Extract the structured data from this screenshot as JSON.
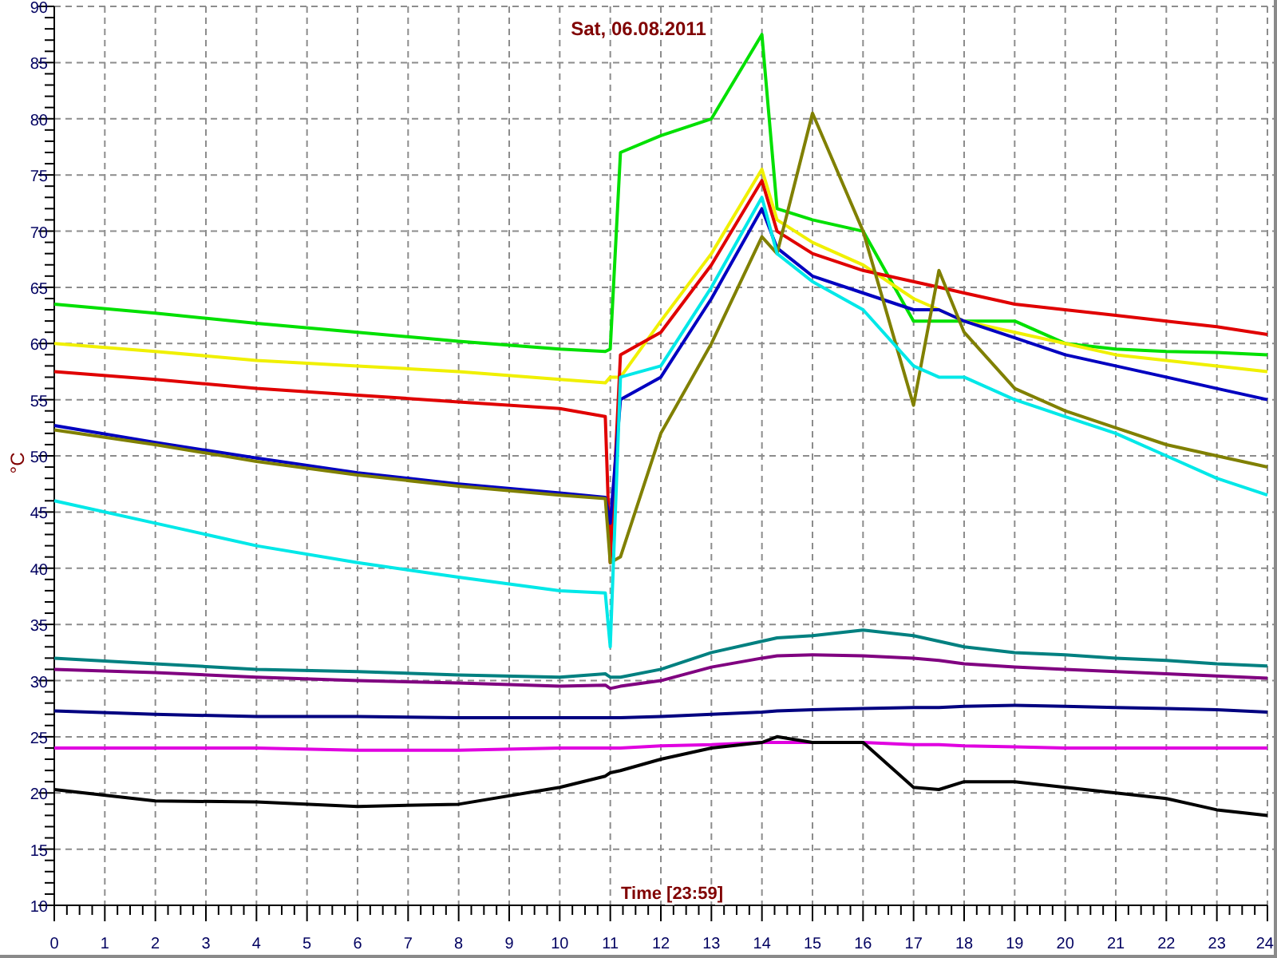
{
  "chart": {
    "chart_data": {
      "type": "line",
      "title": "Sat, 06.08.2011",
      "xlabel": "Time [23:59]",
      "ylabel": "°C",
      "x": [
        0,
        2,
        4,
        6,
        8,
        10,
        10.9,
        11,
        11.2,
        12,
        13,
        14,
        14.3,
        15,
        16,
        17,
        17.5,
        18,
        19,
        20,
        21,
        22,
        23,
        24
      ],
      "xlim": [
        0,
        24
      ],
      "ylim": [
        10,
        90
      ],
      "grid": true,
      "xticks": [
        0,
        1,
        2,
        3,
        4,
        5,
        6,
        7,
        8,
        9,
        10,
        11,
        12,
        13,
        14,
        15,
        16,
        17,
        18,
        19,
        20,
        21,
        22,
        23,
        24
      ],
      "yticks": [
        10,
        15,
        20,
        25,
        30,
        35,
        40,
        45,
        50,
        55,
        60,
        65,
        70,
        75,
        80,
        85,
        90
      ],
      "series": [
        {
          "color": "#00e000",
          "values": [
            63.5,
            62.7,
            61.8,
            61,
            60.2,
            59.5,
            59.3,
            59.5,
            77,
            78.5,
            80,
            87.5,
            72,
            71,
            70,
            62,
            62,
            62,
            62,
            60,
            59.5,
            59.3,
            59.2,
            59
          ]
        },
        {
          "color": "#f0f000",
          "values": [
            60,
            59.3,
            58.5,
            58,
            57.5,
            56.8,
            56.5,
            57,
            57,
            62,
            68,
            75.5,
            71,
            69,
            67,
            64,
            63,
            62,
            61,
            60,
            59,
            58.5,
            58,
            57.5
          ]
        },
        {
          "color": "#e00000",
          "values": [
            57.5,
            56.8,
            56,
            55.4,
            54.8,
            54.2,
            53.5,
            40.5,
            59,
            61,
            67,
            74.5,
            70,
            68,
            66.5,
            65.5,
            65,
            64.5,
            63.5,
            63,
            62.5,
            62,
            61.5,
            60.8
          ]
        },
        {
          "color": "#0000c0",
          "values": [
            52.7,
            51.2,
            49.8,
            48.5,
            47.5,
            46.7,
            46.3,
            44,
            55,
            57,
            64,
            72,
            68.5,
            66,
            64.5,
            63,
            63,
            62,
            60.5,
            59,
            58,
            57,
            56,
            55
          ]
        },
        {
          "color": "#808000",
          "values": [
            52.3,
            51,
            49.5,
            48.3,
            47.3,
            46.5,
            46.2,
            40.5,
            41,
            52,
            60,
            69.5,
            68,
            80.5,
            70,
            54.5,
            66.5,
            61,
            56,
            54,
            52.5,
            51,
            50,
            49
          ]
        },
        {
          "color": "#00e8e8",
          "values": [
            46,
            44,
            42,
            40.5,
            39.2,
            38,
            37.8,
            33,
            57,
            58,
            65,
            73,
            68,
            65.5,
            63,
            58,
            57,
            57,
            55,
            53.5,
            52,
            50,
            48,
            46.5
          ]
        },
        {
          "color": "#008080",
          "values": [
            32,
            31.5,
            31,
            30.8,
            30.5,
            30.3,
            30.6,
            30.3,
            30.3,
            31,
            32.5,
            33.5,
            33.8,
            34,
            34.5,
            34,
            33.5,
            33,
            32.5,
            32.3,
            32,
            31.8,
            31.5,
            31.3
          ]
        },
        {
          "color": "#800080",
          "values": [
            31,
            30.7,
            30.3,
            30,
            29.8,
            29.5,
            29.6,
            29.3,
            29.5,
            30,
            31.2,
            32,
            32.2,
            32.3,
            32.2,
            32,
            31.8,
            31.5,
            31.2,
            31,
            30.8,
            30.6,
            30.4,
            30.2
          ]
        },
        {
          "color": "#000080",
          "values": [
            27.3,
            27,
            26.8,
            26.8,
            26.7,
            26.7,
            26.7,
            26.7,
            26.7,
            26.8,
            27,
            27.2,
            27.3,
            27.4,
            27.5,
            27.6,
            27.6,
            27.7,
            27.8,
            27.7,
            27.6,
            27.5,
            27.4,
            27.2
          ]
        },
        {
          "color": "#e000e0",
          "values": [
            24,
            24,
            24,
            23.8,
            23.8,
            24,
            24,
            24,
            24,
            24.2,
            24.3,
            24.5,
            24.5,
            24.5,
            24.5,
            24.3,
            24.3,
            24.2,
            24.1,
            24,
            24,
            24,
            24,
            24
          ]
        },
        {
          "color": "#000000",
          "values": [
            20.3,
            19.3,
            19.2,
            18.8,
            19,
            20.5,
            21.5,
            21.8,
            22,
            23,
            24,
            24.5,
            25,
            24.5,
            24.5,
            20.5,
            20.3,
            21,
            21,
            20.5,
            20,
            19.5,
            18.5,
            18
          ]
        }
      ]
    }
  }
}
